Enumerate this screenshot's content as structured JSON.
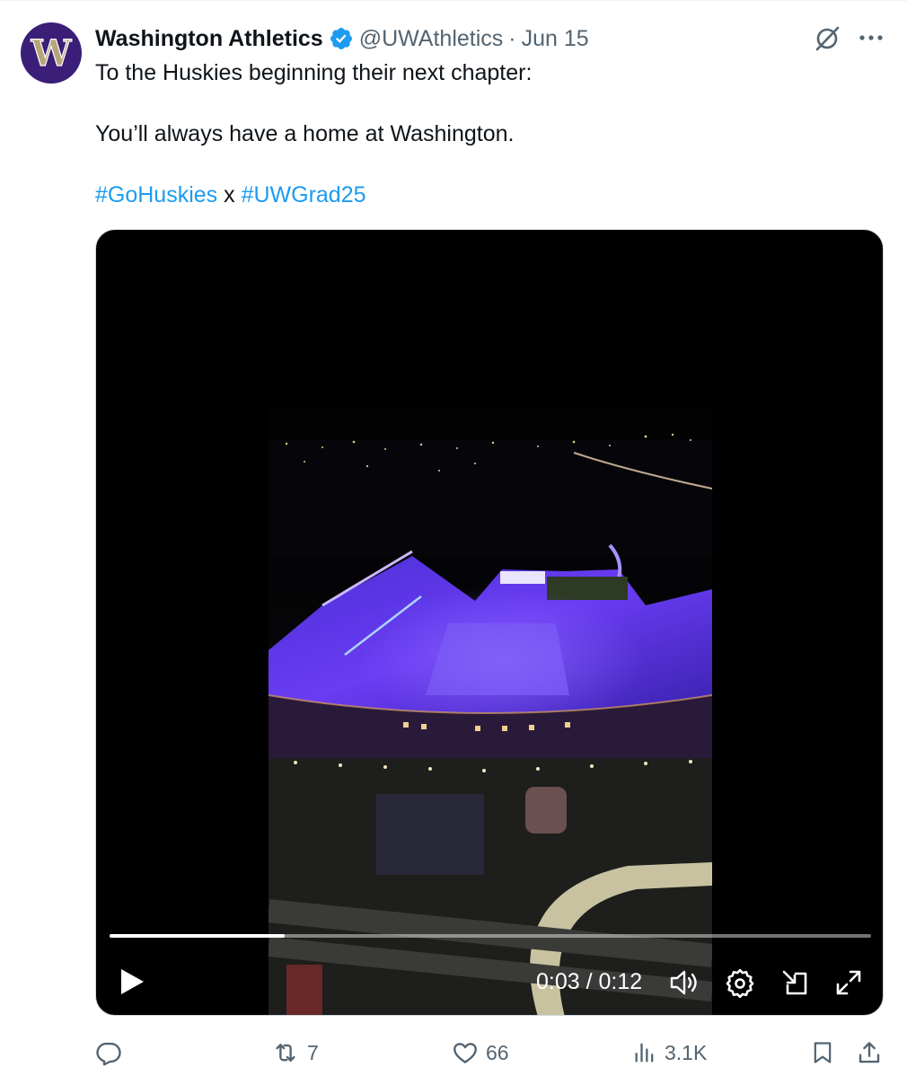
{
  "tweet": {
    "author": {
      "name": "Washington Athletics",
      "handle": "@UWAthletics",
      "avatar_letter": "W",
      "verified": true
    },
    "separator": "·",
    "date": "Jun 15",
    "text_lines": [
      "To the Huskies beginning their next chapter:",
      "You’ll always have a home at Washington."
    ],
    "hashtags": [
      "#GoHuskies",
      "#UWGrad25"
    ],
    "hashtag_joiner": "x",
    "icons": {
      "grok": "grok-icon",
      "more": "more-dots-icon"
    }
  },
  "video": {
    "current_time": "0:03",
    "duration": "0:12",
    "time_separator": " / ",
    "progress_fraction": 0.23,
    "controls": [
      "play-icon",
      "volume-icon",
      "settings-icon",
      "picture-in-picture-icon",
      "fullscreen-icon"
    ]
  },
  "actions": {
    "reply": {
      "icon": "reply-icon",
      "count": ""
    },
    "repost": {
      "icon": "repost-icon",
      "count": "7"
    },
    "like": {
      "icon": "heart-icon",
      "count": "66"
    },
    "views": {
      "icon": "views-icon",
      "count": "3.1K"
    },
    "bookmark": {
      "icon": "bookmark-icon"
    },
    "share": {
      "icon": "share-icon"
    }
  },
  "colors": {
    "link": "#1d9bf0",
    "secondary_text": "#536471",
    "verified_badge": "#1d9bf0",
    "avatar_bg": "#3b1e78",
    "avatar_letter": "#b7a57a"
  }
}
